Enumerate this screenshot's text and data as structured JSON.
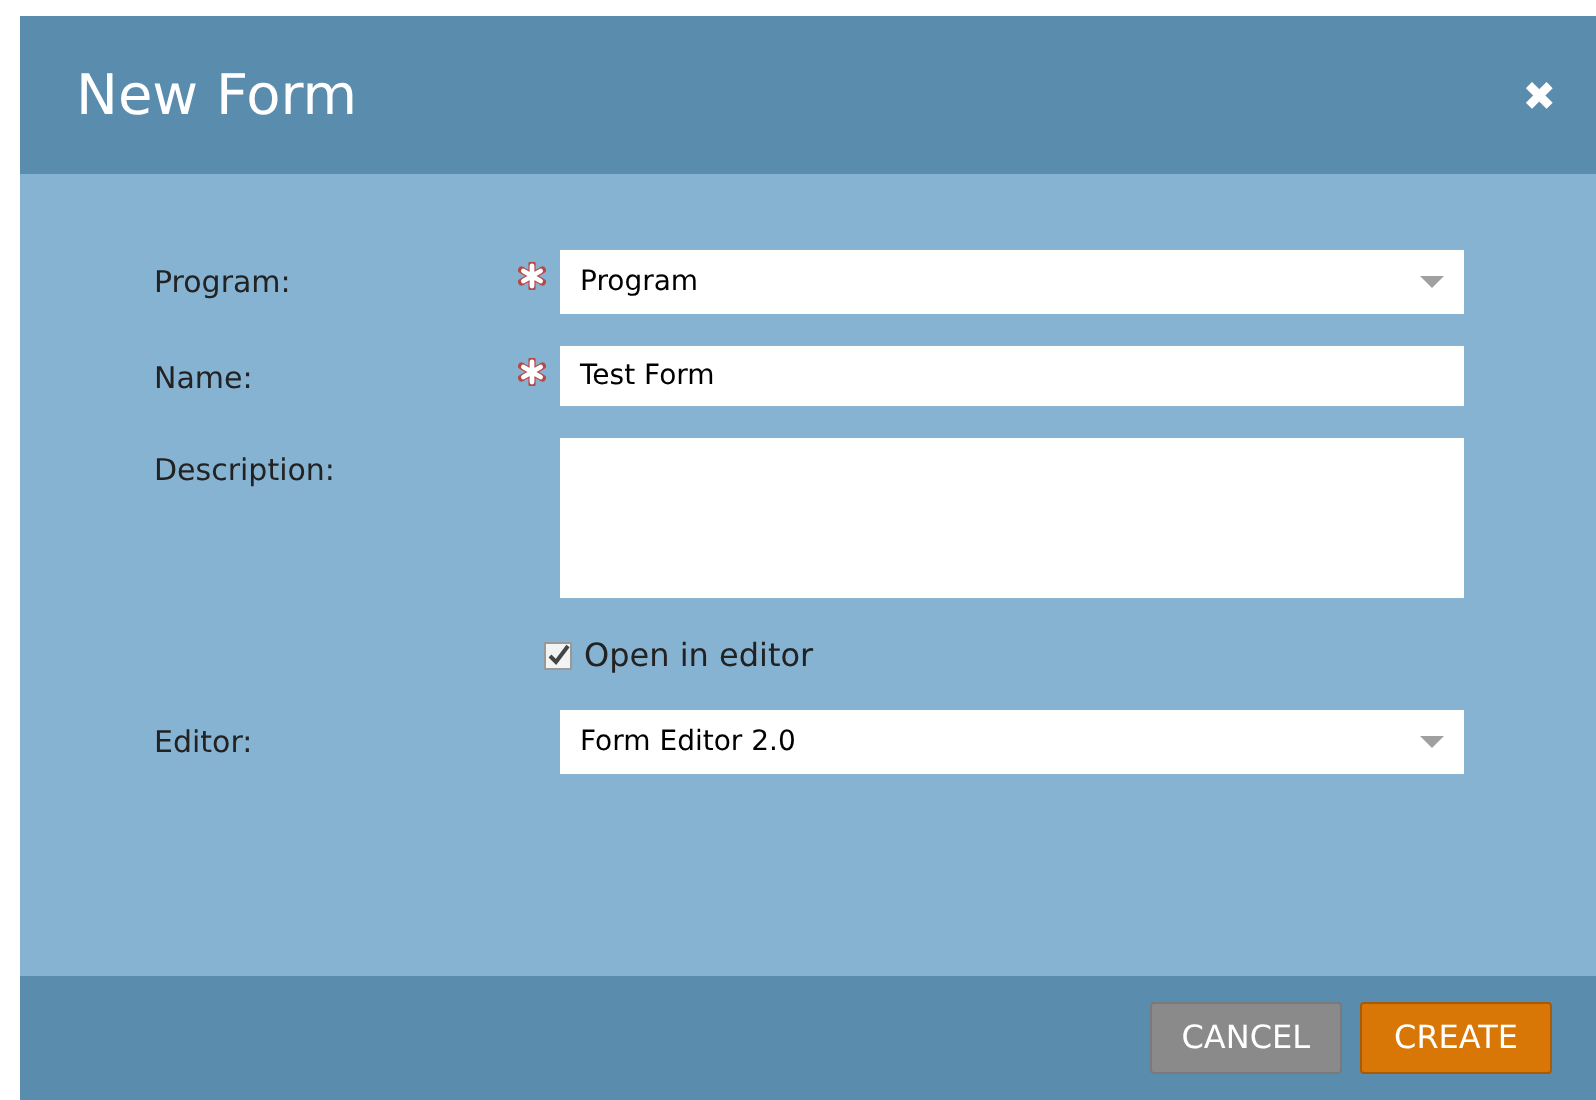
{
  "dialog": {
    "title": "New Form",
    "close": "✖"
  },
  "fields": [
    {
      "kind": "select",
      "label": "Program:",
      "required": true,
      "value": "Program"
    },
    {
      "kind": "text",
      "label": "Name:",
      "required": true,
      "value": "Test Form"
    },
    {
      "kind": "textarea",
      "label": "Description:",
      "required": false
    },
    {
      "kind": "checkbox",
      "label": "Open in editor",
      "checked": true
    },
    {
      "kind": "select",
      "label": "Editor:",
      "required": false,
      "value": "Form Editor 2.0"
    }
  ],
  "buttons": [
    {
      "label": "CANCEL",
      "kind": "secondary"
    },
    {
      "label": "CREATE",
      "kind": "primary"
    }
  ]
}
